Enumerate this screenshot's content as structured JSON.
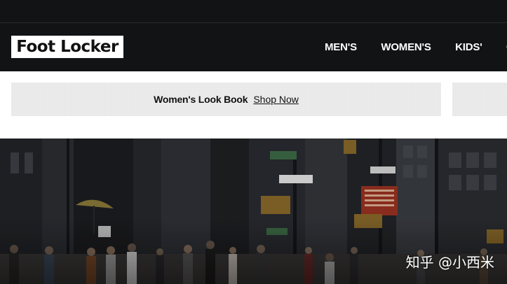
{
  "header": {
    "logo_text": "Foot Locker",
    "nav": [
      "MEN'S",
      "WOMEN'S",
      "KIDS'",
      "C"
    ]
  },
  "promo": {
    "text": "Women's Look Book",
    "link": "Shop Now"
  },
  "hero": {
    "watermark": "知乎 @小西米"
  },
  "colors": {
    "nav_bg": "#111315",
    "promo_bg": "#ececec"
  }
}
